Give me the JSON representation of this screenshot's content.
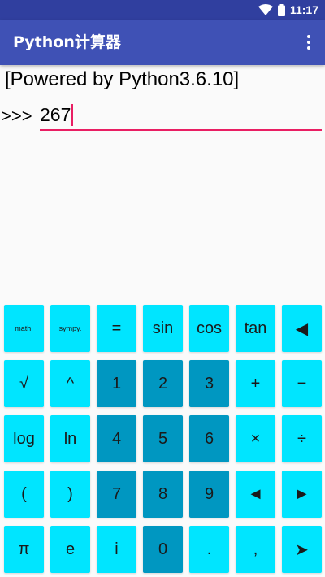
{
  "status_bar": {
    "time": "11:17"
  },
  "app_bar": {
    "title": "Python计算器"
  },
  "console": {
    "banner": "[Powered by Python3.6.10]",
    "prompt": ">>>",
    "input_value": "267"
  },
  "colors": {
    "primary": "#3f51b5",
    "primary_dark": "#303f9f",
    "accent": "#e91e63",
    "key_light": "#00e5ff",
    "key_dark": "#0097c1"
  },
  "keys": [
    {
      "label": "math.",
      "name": "math-key",
      "style": "light small"
    },
    {
      "label": "sympy.",
      "name": "sympy-key",
      "style": "light small"
    },
    {
      "label": "=",
      "name": "equals-key",
      "style": "light"
    },
    {
      "label": "sin",
      "name": "sin-key",
      "style": "light"
    },
    {
      "label": "cos",
      "name": "cos-key",
      "style": "light"
    },
    {
      "label": "tan",
      "name": "tan-key",
      "style": "light"
    },
    {
      "label": "◀",
      "name": "backspace-key",
      "style": "light"
    },
    {
      "label": "√",
      "name": "sqrt-key",
      "style": "light"
    },
    {
      "label": "^",
      "name": "power-key",
      "style": "light"
    },
    {
      "label": "1",
      "name": "digit-1-key",
      "style": "dark"
    },
    {
      "label": "2",
      "name": "digit-2-key",
      "style": "dark"
    },
    {
      "label": "3",
      "name": "digit-3-key",
      "style": "dark"
    },
    {
      "label": "+",
      "name": "plus-key",
      "style": "light"
    },
    {
      "label": "−",
      "name": "minus-key",
      "style": "light"
    },
    {
      "label": "log",
      "name": "log-key",
      "style": "light"
    },
    {
      "label": "ln",
      "name": "ln-key",
      "style": "light"
    },
    {
      "label": "4",
      "name": "digit-4-key",
      "style": "dark"
    },
    {
      "label": "5",
      "name": "digit-5-key",
      "style": "dark"
    },
    {
      "label": "6",
      "name": "digit-6-key",
      "style": "dark"
    },
    {
      "label": "×",
      "name": "multiply-key",
      "style": "light"
    },
    {
      "label": "÷",
      "name": "divide-key",
      "style": "light"
    },
    {
      "label": "(",
      "name": "open-paren-key",
      "style": "light"
    },
    {
      "label": ")",
      "name": "close-paren-key",
      "style": "light"
    },
    {
      "label": "7",
      "name": "digit-7-key",
      "style": "dark"
    },
    {
      "label": "8",
      "name": "digit-8-key",
      "style": "dark"
    },
    {
      "label": "9",
      "name": "digit-9-key",
      "style": "dark"
    },
    {
      "label": "◄",
      "name": "cursor-left-key",
      "style": "light"
    },
    {
      "label": "►",
      "name": "cursor-right-key",
      "style": "light"
    },
    {
      "label": "π",
      "name": "pi-key",
      "style": "light"
    },
    {
      "label": "e",
      "name": "e-key",
      "style": "light"
    },
    {
      "label": "i",
      "name": "imaginary-key",
      "style": "light"
    },
    {
      "label": "0",
      "name": "digit-0-key",
      "style": "dark"
    },
    {
      "label": ".",
      "name": "decimal-key",
      "style": "light"
    },
    {
      "label": ",",
      "name": "comma-key",
      "style": "light"
    },
    {
      "label": "➤",
      "name": "enter-key",
      "style": "light"
    }
  ]
}
